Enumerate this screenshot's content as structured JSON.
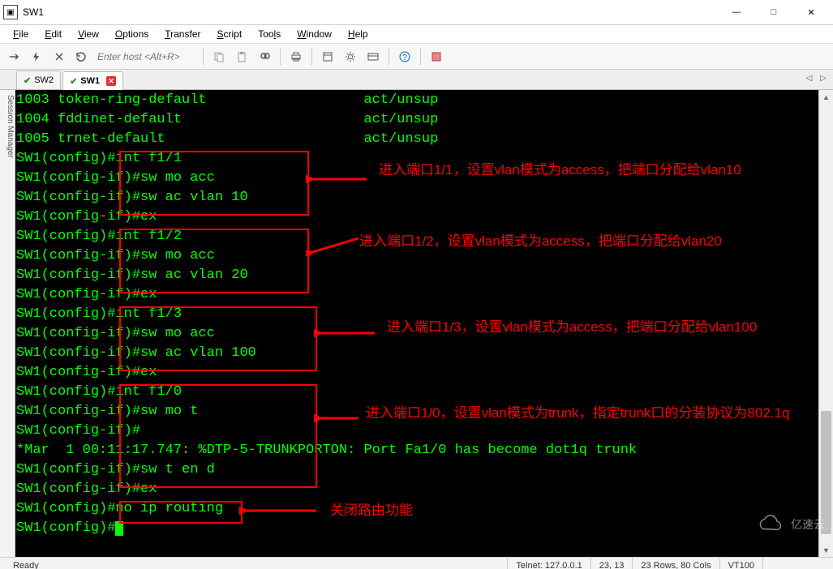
{
  "window": {
    "title": "SW1",
    "minimize": "—",
    "maximize": "□",
    "close": "✕"
  },
  "menu": {
    "file": "File",
    "edit": "Edit",
    "view": "View",
    "options": "Options",
    "transfer": "Transfer",
    "script": "Script",
    "tools": "Tools",
    "window": "Window",
    "help": "Help"
  },
  "toolbar": {
    "host_placeholder": "Enter host <Alt+R>"
  },
  "side": {
    "label": "Session Manager"
  },
  "tabs": {
    "t1": {
      "label": "SW2"
    },
    "t2": {
      "label": "SW1"
    }
  },
  "terminal": {
    "l1": "1003 token-ring-default                   act/unsup",
    "l2": "1004 fddinet-default                      act/unsup",
    "l3": "1005 trnet-default                        act/unsup",
    "l4": "SW1(config)#int f1/1",
    "l5": "SW1(config-if)#sw mo acc",
    "l6": "SW1(config-if)#sw ac vlan 10",
    "l7": "SW1(config-if)#ex",
    "l8": "SW1(config)#int f1/2",
    "l9": "SW1(config-if)#sw mo acc",
    "l10": "SW1(config-if)#sw ac vlan 20",
    "l11": "SW1(config-if)#ex",
    "l12": "SW1(config)#int f1/3",
    "l13": "SW1(config-if)#sw mo acc",
    "l14": "SW1(config-if)#sw ac vlan 100",
    "l15": "SW1(config-if)#ex",
    "l16": "SW1(config)#int f1/0",
    "l17": "SW1(config-if)#sw mo t",
    "l18": "SW1(config-if)#",
    "l19": "*Mar  1 00:11:17.747: %DTP-5-TRUNKPORTON: Port Fa1/0 has become dot1q trunk",
    "l20": "SW1(config-if)#sw t en d",
    "l21": "SW1(config-if)#ex",
    "l22": "SW1(config)#no ip routing",
    "l23": "SW1(config)#"
  },
  "annotations": {
    "a1": "进入端口1/1，设置vlan模式为access，把端口分配给vlan10",
    "a2": "进入端口1/2，设置vlan模式为access，把端口分配给vlan20",
    "a3": "进入端口1/3，设置vlan模式为access，把端口分配给vlan100",
    "a4": "进入端口1/0，设置vlan模式为trunk，指定trunk口的分装协议为802.1q",
    "a5": "关闭路由功能"
  },
  "status": {
    "ready": "Ready",
    "conn": "Telnet: 127.0.0.1",
    "pos": "23,  13",
    "size": "23 Rows, 80 Cols",
    "term": "VT100"
  },
  "watermark": {
    "text": "亿速云"
  }
}
